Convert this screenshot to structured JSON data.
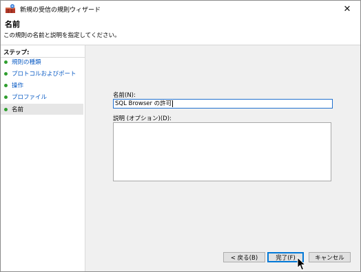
{
  "window": {
    "title": "新規の受信の規則ウィザード",
    "close_glyph": "✕"
  },
  "header": {
    "title": "名前",
    "subtitle": "この規則の名前と説明を指定してください。"
  },
  "steps": {
    "title": "ステップ:",
    "items": [
      {
        "label": "規則の種類",
        "active": false
      },
      {
        "label": "プロトコルおよびポート",
        "active": false
      },
      {
        "label": "操作",
        "active": false
      },
      {
        "label": "プロファイル",
        "active": false
      },
      {
        "label": "名前",
        "active": true
      }
    ]
  },
  "form": {
    "name_label": "名前(N):",
    "name_value": "SQL Browser の許可",
    "description_label": "説明 (オプション)(D):",
    "description_value": ""
  },
  "buttons": {
    "back": "< 戻る(B)",
    "finish": "完了(F)",
    "cancel": "キャンセル"
  },
  "colors": {
    "step_link": "#0a5bc4",
    "step_bullet": "#2f9e2f",
    "focus_border": "#1f6fcf"
  }
}
